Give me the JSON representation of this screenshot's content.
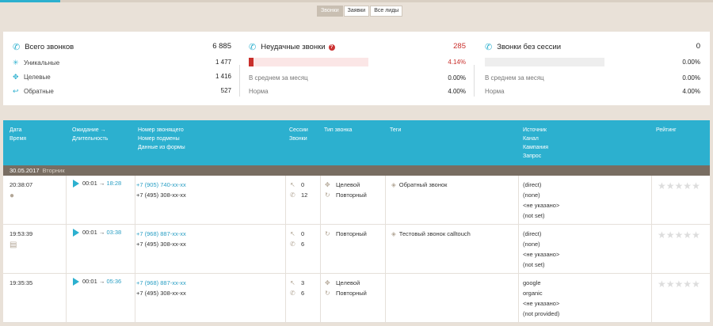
{
  "tabs": [
    {
      "label": "Звонки",
      "active": true
    },
    {
      "label": "Заявки",
      "active": false
    },
    {
      "label": "Все лиды",
      "active": false
    }
  ],
  "stats": {
    "total": {
      "title": "Всего звонков",
      "value": "6 885",
      "rows": [
        {
          "label": "Уникальные",
          "value": "1 477",
          "icon": "asterisk-icon"
        },
        {
          "label": "Целевые",
          "value": "1 416",
          "icon": "target-icon"
        },
        {
          "label": "Обратные",
          "value": "527",
          "icon": "return-arrow-icon"
        }
      ]
    },
    "failed": {
      "title": "Неудачные звонки",
      "value": "285",
      "percent": "4.14%",
      "fill": 0.0414,
      "avg_label": "В среднем за месяц",
      "avg_value": "0.00%",
      "norm_label": "Норма",
      "norm_value": "4.00%"
    },
    "nosession": {
      "title": "Звонки без сессии",
      "value": "0",
      "percent": "0.00%",
      "fill": 0,
      "avg_label": "В среднем за месяц",
      "avg_value": "0.00%",
      "norm_label": "Норма",
      "norm_value": "4.00%"
    }
  },
  "colors": {
    "accent": "#2cb0cf",
    "danger": "#c9302c",
    "group_bg": "#786d62"
  },
  "table": {
    "headers": {
      "date": [
        "Дата",
        "Время"
      ],
      "wait": [
        "Ожидание →",
        "Длительность"
      ],
      "number": [
        "Номер звонящего",
        "Номер подмены",
        "Данные из формы"
      ],
      "sessions": [
        "Сессии",
        "Звонки"
      ],
      "type": [
        "Тип звонка"
      ],
      "tags": [
        "Теги"
      ],
      "source": [
        "Источник",
        "Канал",
        "Кампания",
        "Запрос"
      ],
      "rating": [
        "Рейтинг"
      ]
    },
    "group": {
      "date": "30.05.2017",
      "weekday": "Вторник"
    },
    "rows": [
      {
        "time": "20:38:07",
        "wait": "00:01",
        "duration": "18:28",
        "caller": "+7 (905) 740-xx-xx",
        "subst": "+7 (495) 308-xx-xx",
        "sessions": "0",
        "calls": "12",
        "types": [
          "Целевой",
          "Повторный"
        ],
        "tag": "Обратный звонок",
        "source": [
          "(direct)",
          "(none)",
          "<не указано>",
          "(not set)"
        ]
      },
      {
        "time": "19:53:39",
        "wait": "00:01",
        "duration": "03:38",
        "caller": "+7 (968) 887-xx-xx",
        "subst": "+7 (495) 308-xx-xx",
        "sessions": "0",
        "calls": "6",
        "types": [
          "Повторный"
        ],
        "tag": "Тестовый звонок calltouch",
        "source": [
          "(direct)",
          "(none)",
          "<не указано>",
          "(not set)"
        ]
      },
      {
        "time": "19:35:35",
        "wait": "00:01",
        "duration": "05:36",
        "caller": "+7 (968) 887-xx-xx",
        "subst": "+7 (495) 308-xx-xx",
        "sessions": "3",
        "calls": "6",
        "types": [
          "Целевой",
          "Повторный"
        ],
        "tag": "",
        "source": [
          "google",
          "organic",
          "<не указано>",
          "(not provided)"
        ]
      }
    ]
  }
}
